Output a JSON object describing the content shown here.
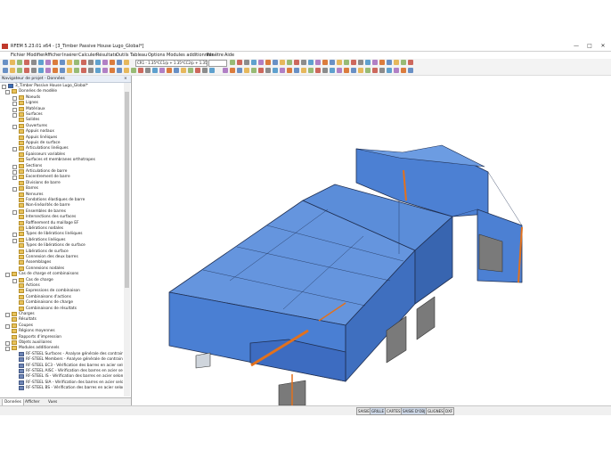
{
  "window": {
    "title": "RFEM 5.23.01 x64 - [3_Timber Passive House Lugo_Global*]",
    "controls": [
      "—",
      "□",
      "✕"
    ]
  },
  "menu": [
    "Fichier",
    "Modifier",
    "Afficher",
    "Insérer",
    "Calculer",
    "Résultats",
    "Outils",
    "Tableau",
    "Options",
    "Modules additionnels",
    "Fenêtre",
    "Aide"
  ],
  "toolbar": {
    "load_combo": "CR1 - 1.35*CC1/p + 1.35*CC2/p + 1.35*",
    "small_combo": "",
    "icon_colors": [
      "#3b6fb6",
      "#e2a42a",
      "#7aa84b",
      "#c0392b",
      "#6a6a6a",
      "#2e86c1",
      "#9b59b6",
      "#d35400"
    ]
  },
  "navigator": {
    "title": "Navigateur de projet - Données",
    "close": "×",
    "project": "3_Timber Passive House Lugo_Global*",
    "items": [
      {
        "label": "Données de modèle",
        "level": 1,
        "icon": "folder",
        "exp": "-"
      },
      {
        "label": "Noeuds",
        "level": 2,
        "icon": "folder",
        "exp": "+"
      },
      {
        "label": "Lignes",
        "level": 2,
        "icon": "folder",
        "exp": "+"
      },
      {
        "label": "Matériaux",
        "level": 2,
        "icon": "folder",
        "exp": "+"
      },
      {
        "label": "Surfaces",
        "level": 2,
        "icon": "folder",
        "exp": "+"
      },
      {
        "label": "Solides",
        "level": 2,
        "icon": "folder",
        "exp": ""
      },
      {
        "label": "Ouvertures",
        "level": 2,
        "icon": "folder",
        "exp": "+"
      },
      {
        "label": "Appuis nodaux",
        "level": 2,
        "icon": "folder",
        "exp": ""
      },
      {
        "label": "Appuis linéiques",
        "level": 2,
        "icon": "folder",
        "exp": ""
      },
      {
        "label": "Appuis de surface",
        "level": 2,
        "icon": "folder",
        "exp": ""
      },
      {
        "label": "Articulations linéiques",
        "level": 2,
        "icon": "folder",
        "exp": "+"
      },
      {
        "label": "Épaisseurs variables",
        "level": 2,
        "icon": "folder",
        "exp": ""
      },
      {
        "label": "Surfaces et membranes orthotropes",
        "level": 2,
        "icon": "folder",
        "exp": ""
      },
      {
        "label": "Sections",
        "level": 2,
        "icon": "folder",
        "exp": "+"
      },
      {
        "label": "Articulations de barre",
        "level": 2,
        "icon": "folder",
        "exp": "+"
      },
      {
        "label": "Excentrement de barre",
        "level": 2,
        "icon": "folder",
        "exp": "+"
      },
      {
        "label": "Divisions de barre",
        "level": 2,
        "icon": "folder",
        "exp": ""
      },
      {
        "label": "Barres",
        "level": 2,
        "icon": "folder",
        "exp": "+"
      },
      {
        "label": "Nervures",
        "level": 2,
        "icon": "folder",
        "exp": ""
      },
      {
        "label": "Fondations élastiques de barre",
        "level": 2,
        "icon": "folder",
        "exp": ""
      },
      {
        "label": "Non-linéarités de barre",
        "level": 2,
        "icon": "folder",
        "exp": ""
      },
      {
        "label": "Ensembles de barres",
        "level": 2,
        "icon": "folder",
        "exp": "+"
      },
      {
        "label": "Intersections des surfaces",
        "level": 2,
        "icon": "folder",
        "exp": ""
      },
      {
        "label": "Raffinement du maillage EF",
        "level": 2,
        "icon": "folder",
        "exp": ""
      },
      {
        "label": "Libérations nodales",
        "level": 2,
        "icon": "folder",
        "exp": ""
      },
      {
        "label": "Types de libérations linéiques",
        "level": 2,
        "icon": "folder",
        "exp": "+"
      },
      {
        "label": "Libérations linéiques",
        "level": 2,
        "icon": "folder",
        "exp": "+"
      },
      {
        "label": "Types de libérations de surface",
        "level": 2,
        "icon": "folder",
        "exp": ""
      },
      {
        "label": "Libérations de surface",
        "level": 2,
        "icon": "folder",
        "exp": ""
      },
      {
        "label": "Connexion des deux barres",
        "level": 2,
        "icon": "folder",
        "exp": ""
      },
      {
        "label": "Assemblages",
        "level": 2,
        "icon": "folder",
        "exp": ""
      },
      {
        "label": "Connexions nodales",
        "level": 2,
        "icon": "folder",
        "exp": ""
      },
      {
        "label": "Cas de charge et combinaisons",
        "level": 1,
        "icon": "folder",
        "exp": "-"
      },
      {
        "label": "Cas de charge",
        "level": 2,
        "icon": "folder",
        "exp": "+"
      },
      {
        "label": "Actions",
        "level": 2,
        "icon": "folder",
        "exp": ""
      },
      {
        "label": "Expressions de combinaison",
        "level": 2,
        "icon": "folder",
        "exp": ""
      },
      {
        "label": "Combinaisons d'actions",
        "level": 2,
        "icon": "folder",
        "exp": ""
      },
      {
        "label": "Combinaisons de charge",
        "level": 2,
        "icon": "folder",
        "exp": ""
      },
      {
        "label": "Combinaisons de résultats",
        "level": 2,
        "icon": "folder",
        "exp": ""
      },
      {
        "label": "Charges",
        "level": 1,
        "icon": "folder",
        "exp": "+"
      },
      {
        "label": "Résultats",
        "level": 1,
        "icon": "folder",
        "exp": ""
      },
      {
        "label": "Coupes",
        "level": 1,
        "icon": "folder",
        "exp": "+"
      },
      {
        "label": "Régions moyennes",
        "level": 1,
        "icon": "folder",
        "exp": ""
      },
      {
        "label": "Rapports d'impression",
        "level": 1,
        "icon": "folder",
        "exp": ""
      },
      {
        "label": "Objets auxiliaires",
        "level": 1,
        "icon": "folder",
        "exp": "+"
      },
      {
        "label": "Modules additionnels",
        "level": 1,
        "icon": "folder",
        "exp": "-"
      },
      {
        "label": "RF-STEEL Surfaces - Analyse générale des contraintes des",
        "level": 2,
        "icon": "rf",
        "exp": ""
      },
      {
        "label": "RF-STEEL Members - Analyse générale de contraintes des b",
        "level": 2,
        "icon": "rf",
        "exp": ""
      },
      {
        "label": "RF-STEEL EC3 - Vérification des barres en acier selon l'Eur",
        "level": 2,
        "icon": "rf",
        "exp": ""
      },
      {
        "label": "RF-STEEL AISC - Vérification des barres en acier selon AIS",
        "level": 2,
        "icon": "rf",
        "exp": ""
      },
      {
        "label": "RF-STEEL IS - Vérification des barres en acier selon IS",
        "level": 2,
        "icon": "rf",
        "exp": ""
      },
      {
        "label": "RF-STEEL SIA - Vérification des barres en acier selon SIA",
        "level": 2,
        "icon": "rf",
        "exp": ""
      },
      {
        "label": "RF-STEEL BS - Vérification des barres en acier selon BS",
        "level": 2,
        "icon": "rf",
        "exp": ""
      }
    ],
    "tabs": [
      "Données",
      "Afficher",
      "Vues"
    ]
  },
  "status_buttons": [
    "SAISIE",
    "GRILLE",
    "CARTES",
    "SAISIE D'OBJ",
    "GLIGNES",
    "DXF"
  ],
  "colors": {
    "glass": "#4f86d8",
    "glass_dark": "#3563a8",
    "edge": "#1f2f52",
    "beam": "#e2711d",
    "wall_dark": "#7a7a7a"
  }
}
